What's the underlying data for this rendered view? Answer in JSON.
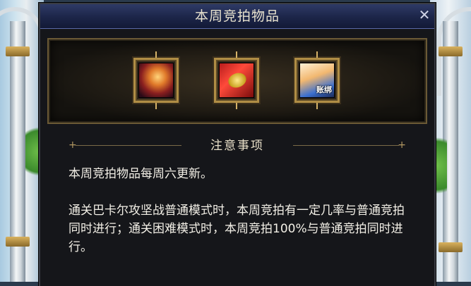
{
  "dialog": {
    "title": "本周竞拍物品",
    "close_glyph": "✕"
  },
  "rewards": {
    "items": [
      {
        "icon": "orb-icon",
        "label": ""
      },
      {
        "icon": "gold-scroll-icon",
        "label": ""
      },
      {
        "icon": "gift-box-icon",
        "label": "账绑"
      }
    ]
  },
  "notice": {
    "title": "注意事项",
    "paragraph_1": "本周竞拍物品每周六更新。",
    "paragraph_2": "通关巴卡尔攻坚战普通模式时，本周竞拍有一定几率与普通竞拍同时进行；通关困难模式时，本周竞拍100%与普通竞拍同时进行。"
  }
}
